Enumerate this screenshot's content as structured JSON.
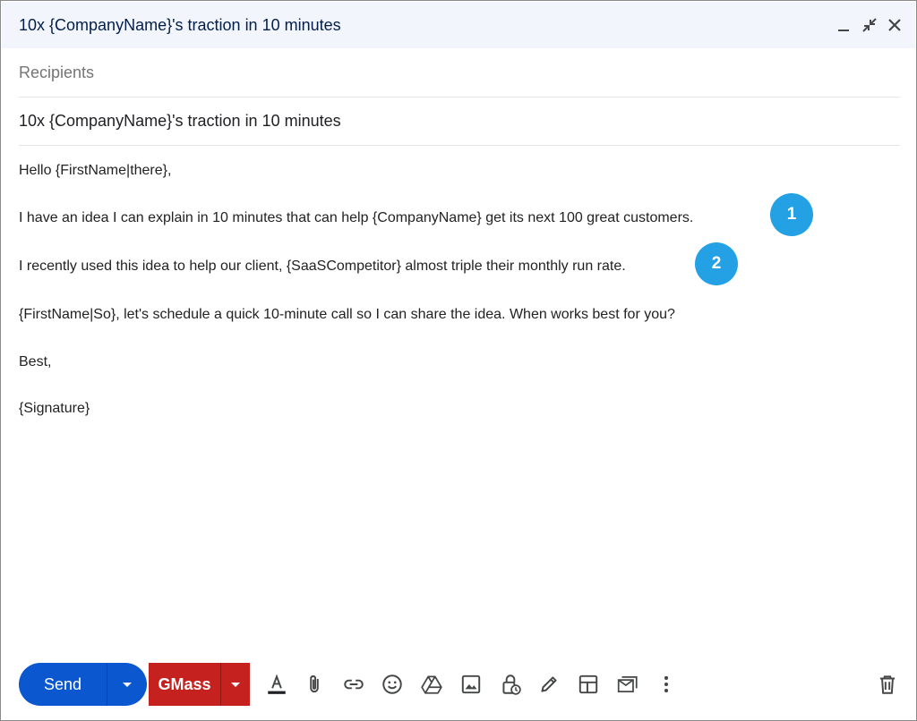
{
  "window": {
    "title": "10x {CompanyName}'s traction in 10 minutes"
  },
  "compose": {
    "recipients_placeholder": "Recipients",
    "subject": "10x {CompanyName}'s traction in 10 minutes",
    "body_lines": [
      "Hello {FirstName|there},",
      "I have an idea I can explain in 10 minutes that can help {CompanyName} get its next 100 great customers.",
      "I recently used this idea to help our client, {SaaSCompetitor} almost triple their monthly run rate.",
      "{FirstName|So}, let's schedule a quick 10-minute call so I can share the idea. When works best for you?",
      "Best,",
      "{Signature}"
    ],
    "annotations": [
      "1",
      "2"
    ]
  },
  "toolbar": {
    "send_label": "Send",
    "gmass_label": "GMass",
    "icons": [
      "text-format-icon",
      "attach-icon",
      "link-icon",
      "emoji-icon",
      "drive-icon",
      "photo-icon",
      "confidential-icon",
      "signature-icon",
      "template-icon",
      "layout-icon",
      "more-options-icon",
      "delete-icon"
    ]
  },
  "colors": {
    "send": "#0b57d0",
    "gmass": "#c5221f",
    "badge": "#23a1e4",
    "titlebar": "#f2f6fc"
  }
}
